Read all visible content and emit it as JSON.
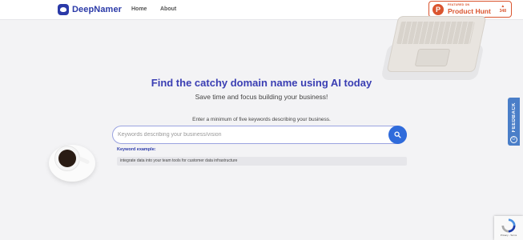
{
  "nav": {
    "logo_text": "DeepNamer",
    "home": "Home",
    "about": "About"
  },
  "product_hunt": {
    "small": "FEATURED ON",
    "big": "Product Hunt",
    "votes": "348",
    "letter": "P"
  },
  "hero": {
    "title": "Find the catchy domain name using AI today",
    "subtitle": "Save time and focus building your business!",
    "hint": "Enter a minimum of five keywords describing your business."
  },
  "search": {
    "placeholder": "Keywords describing your business/vision",
    "value": ""
  },
  "keywords": {
    "label": "Keyword example:",
    "example": "integrate data into your team tools for customer data infrastructure"
  },
  "feedback": {
    "label": "FEEDBACK"
  },
  "recaptcha": {
    "text": "Privacy - Terms"
  },
  "colors": {
    "brand": "#2b3aa8",
    "accent": "#2f6bdb",
    "product_hunt": "#da552f",
    "feedback": "#4a7ec8"
  },
  "icons": [
    "logo-icon",
    "search-icon",
    "feedback-icon",
    "recaptcha-icon",
    "upvote-arrow-icon"
  ]
}
